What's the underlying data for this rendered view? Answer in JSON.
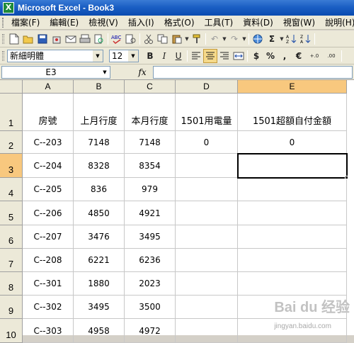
{
  "window": {
    "title": "Microsoft Excel - Book3",
    "app_icon": "X"
  },
  "menu": [
    "檔案(F)",
    "編輯(E)",
    "檢視(V)",
    "插入(I)",
    "格式(O)",
    "工具(T)",
    "資料(D)",
    "視窗(W)",
    "說明(H)"
  ],
  "toolbar_standard": {
    "sigma": "Σ",
    "undo_icon": "↶",
    "redo_icon": "↷"
  },
  "toolbar_format": {
    "font_name": "新細明體",
    "font_size": "12",
    "bold": "B",
    "italic": "I",
    "underline": "U",
    "currency": "$",
    "percent": "%",
    "comma": ",",
    "euro": "€",
    "inc_decimal": "+.0",
    "dec_decimal": ".00"
  },
  "formula_bar": {
    "name_box": "E3",
    "fx": "fx",
    "formula": ""
  },
  "sheet": {
    "active_cell": "E3",
    "columns": [
      "A",
      "B",
      "C",
      "D",
      "E"
    ],
    "rows": [
      "1",
      "2",
      "3",
      "4",
      "5",
      "6",
      "7",
      "8",
      "9",
      "10"
    ],
    "cells": [
      [
        "房號",
        "上月行度",
        "本月行度",
        "1501用電量",
        "1501超額自付金額"
      ],
      [
        "C--203",
        "7148",
        "7148",
        "0",
        "0"
      ],
      [
        "C--204",
        "8328",
        "8354",
        "",
        ""
      ],
      [
        "C--205",
        "836",
        "979",
        "",
        ""
      ],
      [
        "C--206",
        "4850",
        "4921",
        "",
        ""
      ],
      [
        "C--207",
        "3476",
        "3495",
        "",
        ""
      ],
      [
        "C--208",
        "6221",
        "6236",
        "",
        ""
      ],
      [
        "C--301",
        "1880",
        "2023",
        "",
        ""
      ],
      [
        "C--302",
        "3495",
        "3500",
        "",
        ""
      ],
      [
        "C--303",
        "4958",
        "4972",
        "",
        ""
      ]
    ]
  },
  "watermark": {
    "main": "Bai du 经验",
    "sub": "jingyan.baidu.com"
  },
  "colors": {
    "selected_header": "#f8c87e",
    "title_bar": "#1b5fc4",
    "chrome": "#ece9d8"
  }
}
